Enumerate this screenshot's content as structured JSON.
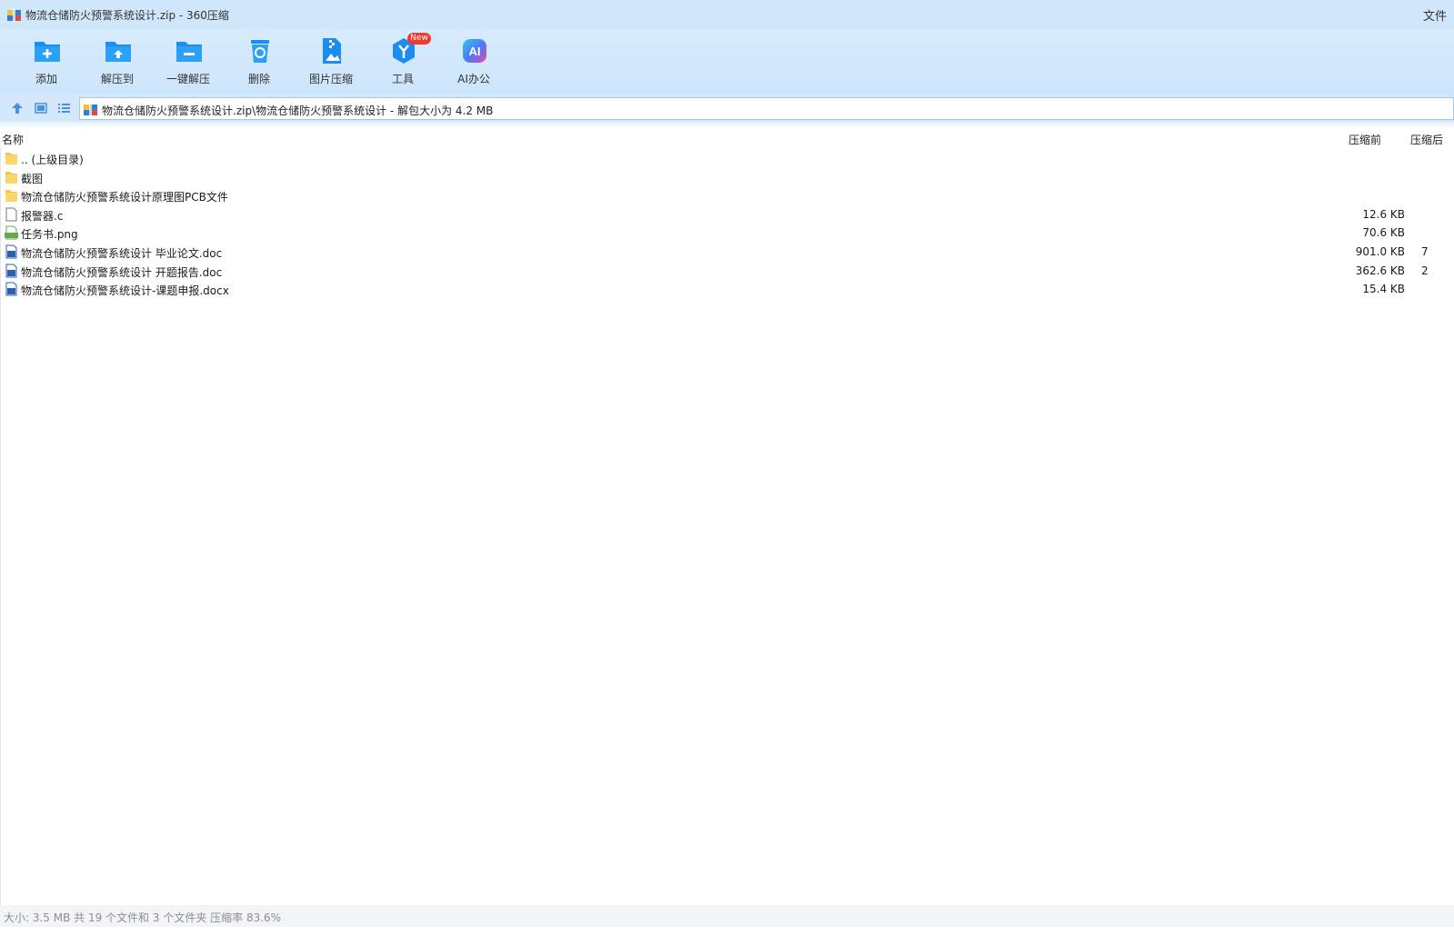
{
  "window": {
    "title": "物流仓储防火预警系统设计.zip - 360压缩",
    "title_right": "文件"
  },
  "toolbar": {
    "items": [
      {
        "label": "添加",
        "icon": "add-folder-icon"
      },
      {
        "label": "解压到",
        "icon": "extract-to-icon"
      },
      {
        "label": "一键解压",
        "icon": "one-click-extract-icon"
      },
      {
        "label": "删除",
        "icon": "recycle-bin-icon"
      },
      {
        "label": "图片压缩",
        "icon": "image-compress-icon"
      },
      {
        "label": "工具",
        "icon": "tools-icon",
        "badge": "New"
      },
      {
        "label": "AI办公",
        "icon": "ai-office-icon"
      }
    ]
  },
  "address": {
    "path": "物流仓储防火预警系统设计.zip\\物流仓储防火预警系统设计 - 解包大小为 4.2 MB"
  },
  "columns": {
    "name": "名称",
    "size_before": "压缩前",
    "size_after": "压缩后"
  },
  "files": [
    {
      "name": ".. (上级目录)",
      "type": "folder",
      "size": "",
      "packed": ""
    },
    {
      "name": "截图",
      "type": "folder",
      "size": "",
      "packed": ""
    },
    {
      "name": "物流仓储防火预警系统设计原理图PCB文件",
      "type": "folder",
      "size": "",
      "packed": ""
    },
    {
      "name": "报警器.c",
      "type": "text",
      "size": "12.6 KB",
      "packed": ""
    },
    {
      "name": "任务书.png",
      "type": "image",
      "size": "70.6 KB",
      "packed": ""
    },
    {
      "name": "物流仓储防火预警系统设计 毕业论文.doc",
      "type": "word",
      "size": "901.0 KB",
      "packed": "7"
    },
    {
      "name": "物流仓储防火预警系统设计 开题报告.doc",
      "type": "word",
      "size": "362.6 KB",
      "packed": "2"
    },
    {
      "name": "物流仓储防火预警系统设计-课题申报.docx",
      "type": "word",
      "size": "15.4 KB",
      "packed": ""
    }
  ],
  "status": {
    "text": "大小: 3.5 MB 共 19 个文件和 3 个文件夹 压缩率 83.6%"
  },
  "colors": {
    "titlebar": "#cfe6fb",
    "toolbar": "#d4e8fc",
    "accent": "#1a8ef0",
    "badge": "#ef3b2d"
  }
}
